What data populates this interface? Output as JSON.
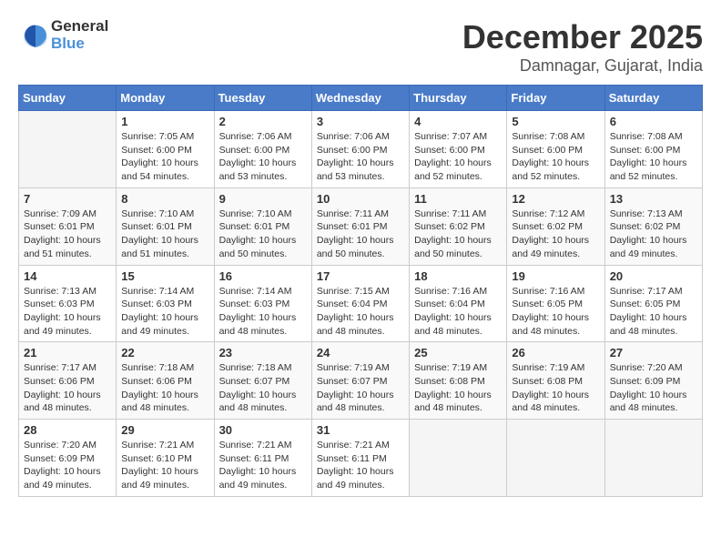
{
  "logo": {
    "general": "General",
    "blue": "Blue"
  },
  "header": {
    "month": "December 2025",
    "location": "Damnagar, Gujarat, India"
  },
  "weekdays": [
    "Sunday",
    "Monday",
    "Tuesday",
    "Wednesday",
    "Thursday",
    "Friday",
    "Saturday"
  ],
  "weeks": [
    [
      {
        "day": "",
        "sunrise": "",
        "sunset": "",
        "daylight": ""
      },
      {
        "day": "1",
        "sunrise": "7:05 AM",
        "sunset": "6:00 PM",
        "daylight": "10 hours and 54 minutes."
      },
      {
        "day": "2",
        "sunrise": "7:06 AM",
        "sunset": "6:00 PM",
        "daylight": "10 hours and 53 minutes."
      },
      {
        "day": "3",
        "sunrise": "7:06 AM",
        "sunset": "6:00 PM",
        "daylight": "10 hours and 53 minutes."
      },
      {
        "day": "4",
        "sunrise": "7:07 AM",
        "sunset": "6:00 PM",
        "daylight": "10 hours and 52 minutes."
      },
      {
        "day": "5",
        "sunrise": "7:08 AM",
        "sunset": "6:00 PM",
        "daylight": "10 hours and 52 minutes."
      },
      {
        "day": "6",
        "sunrise": "7:08 AM",
        "sunset": "6:00 PM",
        "daylight": "10 hours and 52 minutes."
      }
    ],
    [
      {
        "day": "7",
        "sunrise": "7:09 AM",
        "sunset": "6:01 PM",
        "daylight": "10 hours and 51 minutes."
      },
      {
        "day": "8",
        "sunrise": "7:10 AM",
        "sunset": "6:01 PM",
        "daylight": "10 hours and 51 minutes."
      },
      {
        "day": "9",
        "sunrise": "7:10 AM",
        "sunset": "6:01 PM",
        "daylight": "10 hours and 50 minutes."
      },
      {
        "day": "10",
        "sunrise": "7:11 AM",
        "sunset": "6:01 PM",
        "daylight": "10 hours and 50 minutes."
      },
      {
        "day": "11",
        "sunrise": "7:11 AM",
        "sunset": "6:02 PM",
        "daylight": "10 hours and 50 minutes."
      },
      {
        "day": "12",
        "sunrise": "7:12 AM",
        "sunset": "6:02 PM",
        "daylight": "10 hours and 49 minutes."
      },
      {
        "day": "13",
        "sunrise": "7:13 AM",
        "sunset": "6:02 PM",
        "daylight": "10 hours and 49 minutes."
      }
    ],
    [
      {
        "day": "14",
        "sunrise": "7:13 AM",
        "sunset": "6:03 PM",
        "daylight": "10 hours and 49 minutes."
      },
      {
        "day": "15",
        "sunrise": "7:14 AM",
        "sunset": "6:03 PM",
        "daylight": "10 hours and 49 minutes."
      },
      {
        "day": "16",
        "sunrise": "7:14 AM",
        "sunset": "6:03 PM",
        "daylight": "10 hours and 48 minutes."
      },
      {
        "day": "17",
        "sunrise": "7:15 AM",
        "sunset": "6:04 PM",
        "daylight": "10 hours and 48 minutes."
      },
      {
        "day": "18",
        "sunrise": "7:16 AM",
        "sunset": "6:04 PM",
        "daylight": "10 hours and 48 minutes."
      },
      {
        "day": "19",
        "sunrise": "7:16 AM",
        "sunset": "6:05 PM",
        "daylight": "10 hours and 48 minutes."
      },
      {
        "day": "20",
        "sunrise": "7:17 AM",
        "sunset": "6:05 PM",
        "daylight": "10 hours and 48 minutes."
      }
    ],
    [
      {
        "day": "21",
        "sunrise": "7:17 AM",
        "sunset": "6:06 PM",
        "daylight": "10 hours and 48 minutes."
      },
      {
        "day": "22",
        "sunrise": "7:18 AM",
        "sunset": "6:06 PM",
        "daylight": "10 hours and 48 minutes."
      },
      {
        "day": "23",
        "sunrise": "7:18 AM",
        "sunset": "6:07 PM",
        "daylight": "10 hours and 48 minutes."
      },
      {
        "day": "24",
        "sunrise": "7:19 AM",
        "sunset": "6:07 PM",
        "daylight": "10 hours and 48 minutes."
      },
      {
        "day": "25",
        "sunrise": "7:19 AM",
        "sunset": "6:08 PM",
        "daylight": "10 hours and 48 minutes."
      },
      {
        "day": "26",
        "sunrise": "7:19 AM",
        "sunset": "6:08 PM",
        "daylight": "10 hours and 48 minutes."
      },
      {
        "day": "27",
        "sunrise": "7:20 AM",
        "sunset": "6:09 PM",
        "daylight": "10 hours and 48 minutes."
      }
    ],
    [
      {
        "day": "28",
        "sunrise": "7:20 AM",
        "sunset": "6:09 PM",
        "daylight": "10 hours and 49 minutes."
      },
      {
        "day": "29",
        "sunrise": "7:21 AM",
        "sunset": "6:10 PM",
        "daylight": "10 hours and 49 minutes."
      },
      {
        "day": "30",
        "sunrise": "7:21 AM",
        "sunset": "6:11 PM",
        "daylight": "10 hours and 49 minutes."
      },
      {
        "day": "31",
        "sunrise": "7:21 AM",
        "sunset": "6:11 PM",
        "daylight": "10 hours and 49 minutes."
      },
      {
        "day": "",
        "sunrise": "",
        "sunset": "",
        "daylight": ""
      },
      {
        "day": "",
        "sunrise": "",
        "sunset": "",
        "daylight": ""
      },
      {
        "day": "",
        "sunrise": "",
        "sunset": "",
        "daylight": ""
      }
    ]
  ],
  "labels": {
    "sunrise": "Sunrise:",
    "sunset": "Sunset:",
    "daylight": "Daylight:"
  }
}
